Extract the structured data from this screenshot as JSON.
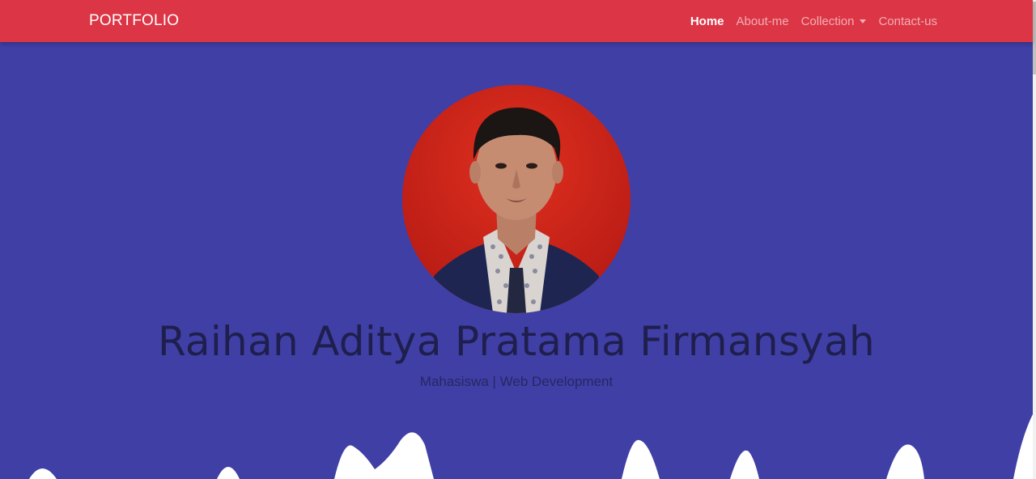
{
  "navbar": {
    "brand": "PORTFOLIO",
    "links": [
      {
        "label": "Home",
        "active": true
      },
      {
        "label": "About-me"
      },
      {
        "label": "Collection",
        "dropdown": true
      },
      {
        "label": "Contact-us"
      }
    ]
  },
  "hero": {
    "name": "Raihan Aditya Pratama Firmansyah",
    "subtitle": "Mahasiswa | Web Development"
  },
  "colors": {
    "navbar_bg": "#dc3545",
    "hero_bg": "#3f3fa6",
    "wave_fill": "#ffffff"
  }
}
